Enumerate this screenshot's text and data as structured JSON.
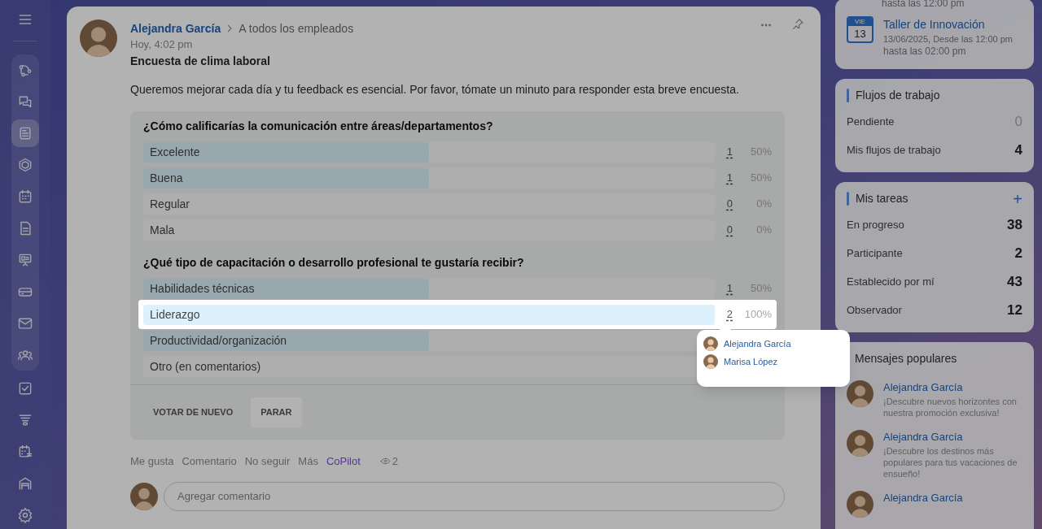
{
  "sidebar": {
    "items": [
      {
        "selected": false
      },
      {
        "selected": false
      },
      {
        "selected": true
      },
      {
        "selected": false
      },
      {
        "selected": false
      },
      {
        "selected": false
      },
      {
        "selected": false
      },
      {
        "selected": false
      },
      {
        "selected": false
      },
      {
        "selected": false
      },
      {
        "selected": false
      },
      {
        "selected": false
      },
      {
        "selected": false
      },
      {
        "selected": false
      },
      {
        "selected": false
      }
    ]
  },
  "post": {
    "author": "Alejandra García",
    "recipient": "A todos los empleados",
    "time": "Hoy, 4:02 pm",
    "title": "Encuesta de clima laboral",
    "body": "Queremos mejorar cada día y tu feedback es esencial. Por favor, tómate un minuto para responder esta breve encuesta.",
    "poll": {
      "questions": [
        {
          "text": "¿Cómo calificarías la comunicación entre áreas/departamentos?",
          "answers": [
            {
              "label": "Excelente",
              "level": 0.5,
              "votes": "1",
              "percent": "50%",
              "highlighted": false
            },
            {
              "label": "Buena",
              "level": 0.5,
              "votes": "1",
              "percent": "50%",
              "highlighted": false
            },
            {
              "label": "Regular",
              "level": 0,
              "votes": "0",
              "percent": "0%",
              "highlighted": false
            },
            {
              "label": "Mala",
              "level": 0,
              "votes": "0",
              "percent": "0%",
              "highlighted": false
            }
          ]
        },
        {
          "text": "¿Qué tipo de capacitación o desarrollo profesional te gustaría recibir?",
          "answers": [
            {
              "label": "Habilidades técnicas",
              "level": 0.5,
              "votes": "1",
              "percent": "50%",
              "highlighted": false
            },
            {
              "label": "Liderazgo",
              "level": 1,
              "votes": "2",
              "percent": "100%",
              "highlighted": true
            },
            {
              "label": "Productividad/organización",
              "level": 0.5,
              "highlighted": false
            },
            {
              "label": "Otro (en comentarios)",
              "level": 0,
              "highlighted": false
            }
          ]
        }
      ],
      "buttons": [
        {
          "label": "VOTAR DE NUEVO",
          "kind": "text"
        },
        {
          "label": "PARAR",
          "kind": "filled"
        }
      ]
    },
    "actions": [
      {
        "label": "Me gusta",
        "kind": "plain"
      },
      {
        "label": "Comentario",
        "kind": "plain"
      },
      {
        "label": "No seguir",
        "kind": "plain"
      },
      {
        "label": "Más",
        "kind": "plain"
      },
      {
        "label": "CoPilot",
        "kind": "copilot"
      }
    ],
    "views": "2",
    "comment_placeholder": "Agregar comentario"
  },
  "voters_popup": {
    "voters": [
      "Alejandra García",
      "Marisa López"
    ]
  },
  "event": {
    "previous_line": "hasta las 12:00 pm",
    "weekday": "VIE",
    "day": "13",
    "title": "Taller de Innovación",
    "when": "13/06/2025, Desde las 12:00 pm",
    "until": "hasta las 02:00 pm"
  },
  "workflows": {
    "title": "Flujos de trabajo",
    "items": [
      {
        "label": "Pendiente",
        "count": "0",
        "muted": true
      },
      {
        "label": "Mis flujos de trabajo",
        "count": "4",
        "muted": false
      }
    ]
  },
  "tasks": {
    "title": "Mis tareas",
    "add": "+",
    "items": [
      {
        "label": "En progreso",
        "count": "38",
        "muted": false
      },
      {
        "label": "Participante",
        "count": "2",
        "muted": false
      },
      {
        "label": "Establecido por mí",
        "count": "43",
        "muted": false
      },
      {
        "label": "Observador",
        "count": "12",
        "muted": false
      }
    ]
  },
  "popular": {
    "title": "Mensajes populares",
    "posts": [
      {
        "author": "Alejandra García",
        "text": "¡Descubre nuevos horizontes con nuestra promoción exclusiva!"
      },
      {
        "author": "Alejandra García",
        "text": "¡Descubre los destinos más populares para tus vacaciones de ensueño!"
      },
      {
        "author": "Alejandra García"
      }
    ]
  }
}
